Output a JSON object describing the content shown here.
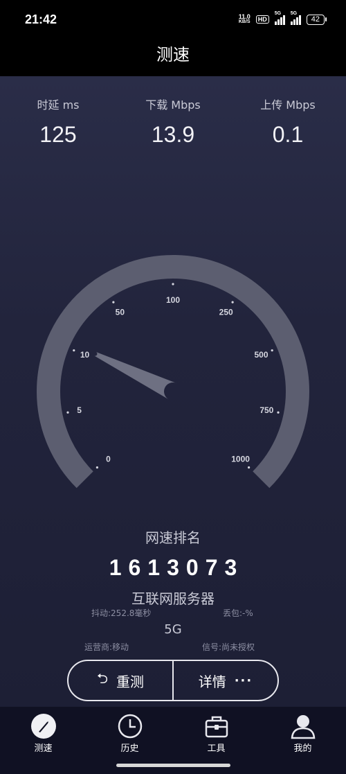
{
  "status_bar": {
    "time": "21:42",
    "net_speed_value": "11.0",
    "net_speed_unit": "KB/S",
    "hd_badge": "HD",
    "signal1_tag": "5G",
    "signal2_tag": "5G",
    "battery": "42"
  },
  "header": {
    "title": "测速"
  },
  "metrics": [
    {
      "label": "时延 ms",
      "value": "125"
    },
    {
      "label": "下载 Mbps",
      "value": "13.9"
    },
    {
      "label": "上传 Mbps",
      "value": "0.1"
    }
  ],
  "gauge": {
    "tick_labels": [
      "0",
      "5",
      "10",
      "50",
      "100",
      "250",
      "500",
      "750",
      "1000"
    ],
    "needle_value": 13.9,
    "colors": {
      "arc": "#5c5e70",
      "needle": "#6e7082",
      "ticks": "#d6d7e0"
    }
  },
  "result": {
    "rank_title": "网速排名",
    "rank_value": "1613073",
    "server": "互联网服务器",
    "jitter": "抖动:252.8毫秒",
    "packet_loss": "丢包:-%",
    "network_type": "5G",
    "operator": "运营商:移动",
    "signal": "信号:尚未授权"
  },
  "actions": {
    "retest_label": "重测",
    "details_label": "详情"
  },
  "tabbar": {
    "items": [
      {
        "label": "测速",
        "icon": "speedometer-icon",
        "active": true
      },
      {
        "label": "历史",
        "icon": "clock-icon",
        "active": false
      },
      {
        "label": "工具",
        "icon": "toolbox-icon",
        "active": false
      },
      {
        "label": "我的",
        "icon": "user-icon",
        "active": false
      }
    ]
  }
}
